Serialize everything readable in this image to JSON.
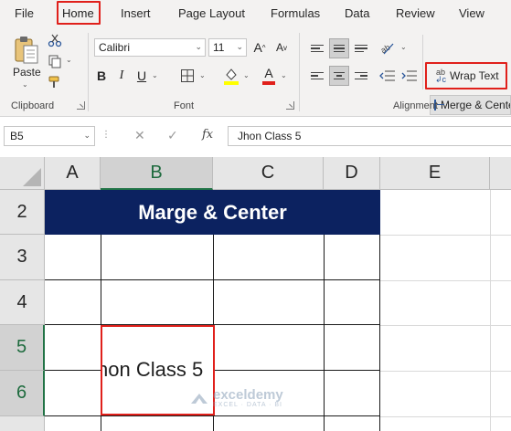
{
  "menu": {
    "tabs": [
      "File",
      "Home",
      "Insert",
      "Page Layout",
      "Formulas",
      "Data",
      "Review",
      "View"
    ],
    "active": "Home"
  },
  "ribbon": {
    "clipboard": {
      "paste_label": "Paste",
      "group_label": "Clipboard"
    },
    "font": {
      "font_name": "Calibri",
      "font_size": "11",
      "group_label": "Font"
    },
    "alignment": {
      "wrap_text_label": "Wrap Text",
      "merge_label": "Merge & Center",
      "group_label": "Alignment"
    }
  },
  "formula_bar": {
    "name_box": "B5",
    "fx_label": "fx",
    "formula": "Jhon Class 5"
  },
  "grid": {
    "columns": [
      "A",
      "B",
      "C",
      "D",
      "E"
    ],
    "selected_column": "B",
    "rows": [
      "2",
      "3",
      "4",
      "5",
      "6"
    ],
    "selected_rows": [
      "5",
      "6"
    ],
    "merged_header_text": "Marge & Center",
    "merged_header_color": "#0c2260",
    "b5_visible_text": "hon Class 5",
    "highlight_color": "#e0201b"
  },
  "watermark": {
    "name": "exceldemy",
    "tagline": "EXCEL · DATA · BI"
  }
}
